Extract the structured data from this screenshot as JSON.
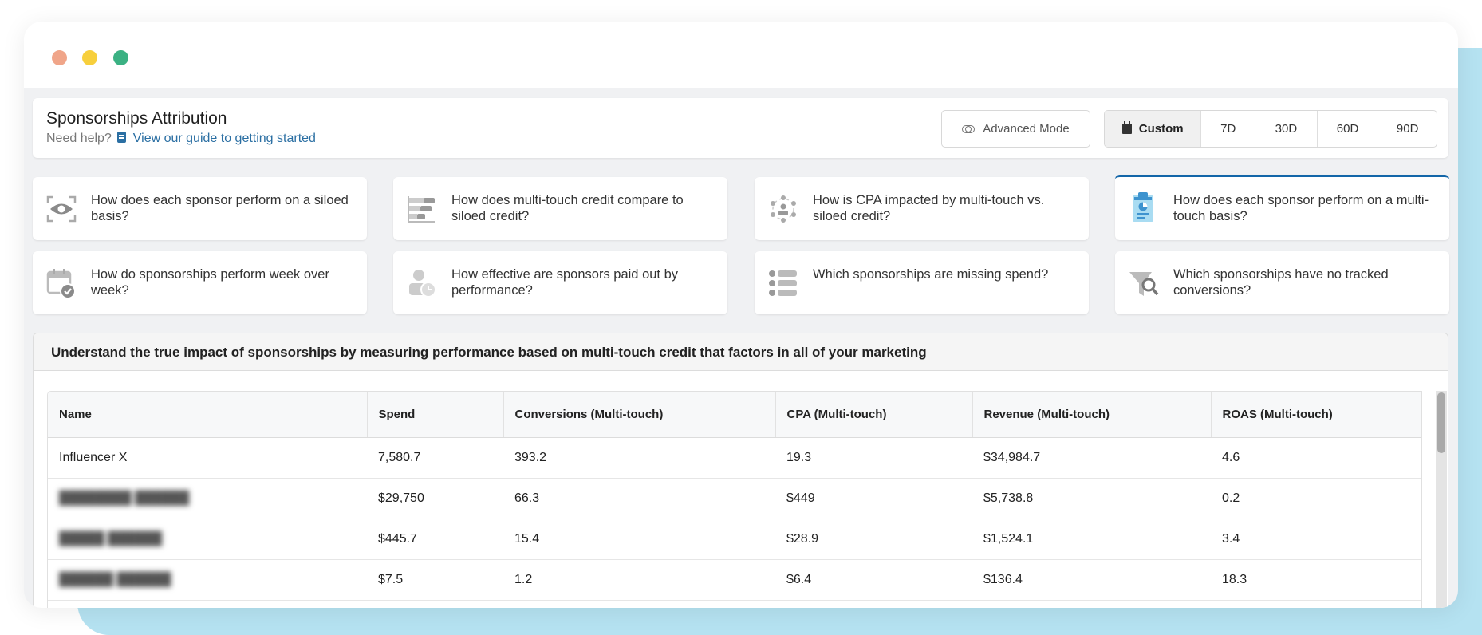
{
  "window": {
    "controls": [
      "close",
      "minimize",
      "maximize"
    ]
  },
  "header": {
    "title": "Sponsorships Attribution",
    "help_prefix": "Need help?",
    "help_icon": "book-icon",
    "help_link": "View our guide to getting started",
    "advanced_mode_label": "Advanced Mode",
    "advanced_mode_icon": "toggle-icon",
    "date_ranges": [
      {
        "label": "Custom",
        "icon": "calendar-icon",
        "active": true
      },
      {
        "label": "7D",
        "active": false
      },
      {
        "label": "30D",
        "active": false
      },
      {
        "label": "60D",
        "active": false
      },
      {
        "label": "90D",
        "active": false
      }
    ]
  },
  "questions": [
    {
      "icon": "eye-scan-icon",
      "text": "How does each sponsor perform on a siloed basis?",
      "active": false
    },
    {
      "icon": "bar-compare-icon",
      "text": "How does multi-touch credit compare to siloed credit?",
      "active": false
    },
    {
      "icon": "network-person-icon",
      "text": "How is CPA impacted by multi-touch vs. siloed credit?",
      "active": false
    },
    {
      "icon": "clipboard-chart-icon",
      "text": "How does each sponsor perform on a multi-touch basis?",
      "active": true
    },
    {
      "icon": "calendar-check-icon",
      "text": "How do sponsorships perform week over week?",
      "active": false
    },
    {
      "icon": "person-clock-icon",
      "text": "How effective are sponsors paid out by performance?",
      "active": false
    },
    {
      "icon": "list-icon",
      "text": "Which sponsorships are missing spend?",
      "active": false
    },
    {
      "icon": "funnel-search-icon",
      "text": "Which sponsorships have no tracked conversions?",
      "active": false
    }
  ],
  "section": {
    "heading": "Understand the true impact of sponsorships by measuring performance based on multi-touch credit that factors in all of your marketing"
  },
  "table": {
    "columns": [
      "Name",
      "Spend",
      "Conversions (Multi-touch)",
      "CPA (Multi-touch)",
      "Revenue (Multi-touch)",
      "ROAS (Multi-touch)"
    ],
    "rows": [
      {
        "name": "Influencer X",
        "name_blurred": false,
        "spend": "7,580.7",
        "conversions": "393.2",
        "cpa": "19.3",
        "revenue": "$34,984.7",
        "roas": "4.6"
      },
      {
        "name": "████████ ██████",
        "name_blurred": true,
        "spend": "$29,750",
        "conversions": "66.3",
        "cpa": "$449",
        "revenue": "$5,738.8",
        "roas": "0.2"
      },
      {
        "name": "█████ ██████",
        "name_blurred": true,
        "spend": "$445.7",
        "conversions": "15.4",
        "cpa": "$28.9",
        "revenue": "$1,524.1",
        "roas": "3.4"
      },
      {
        "name": "██████ ██████",
        "name_blurred": true,
        "spend": "$7.5",
        "conversions": "1.2",
        "cpa": "$6.4",
        "revenue": "$136.4",
        "roas": "18.3"
      }
    ]
  },
  "colors": {
    "accent": "#1366a8",
    "link": "#2b6fa3",
    "backdrop": "#b5e2f1",
    "dot_red": "#f0a589",
    "dot_yellow": "#f7cf3c",
    "dot_green": "#3bb183",
    "active_icon": "#4a9fd4"
  }
}
